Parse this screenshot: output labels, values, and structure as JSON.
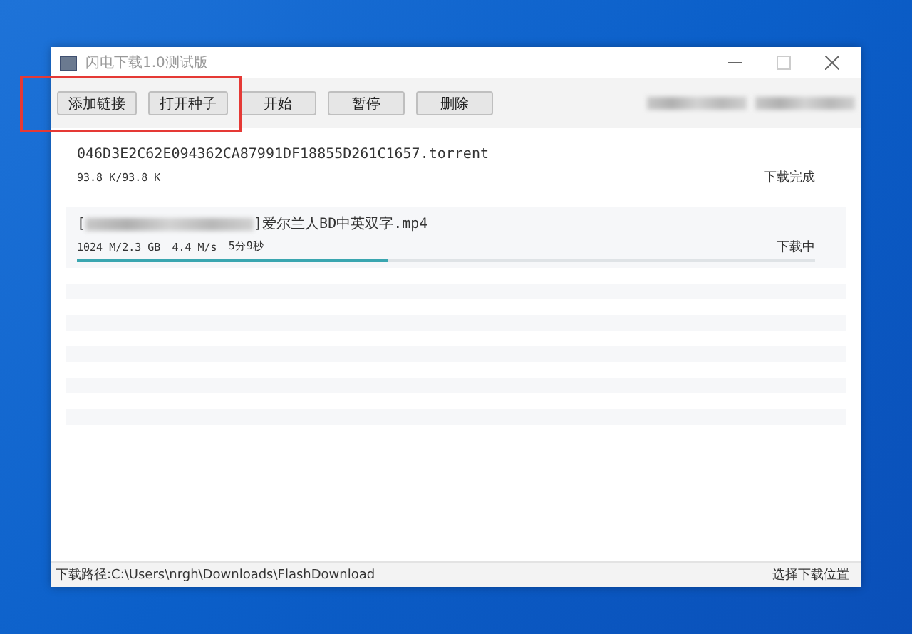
{
  "window": {
    "title": "闪电下载1.0测试版"
  },
  "toolbar": {
    "buttons": [
      "添加链接",
      "打开种子",
      "开始",
      "暂停",
      "删除"
    ]
  },
  "downloads": [
    {
      "name_parts": [
        {
          "kind": "text",
          "text": "046D3E2C62E094362CA87991DF18855D261C1657.torrent"
        }
      ],
      "size": "93.8 K/93.8 K",
      "status": "下载完成"
    },
    {
      "name_parts": [
        {
          "kind": "text",
          "text": "["
        },
        {
          "kind": "redacted"
        },
        {
          "kind": "text",
          "text": "]爱尔兰人BD中英双字.mp4"
        }
      ],
      "size": "1024 M/2.3 GB",
      "speed": "4.4 M/s",
      "remaining": "5分9秒",
      "status": "下载中",
      "level": 0.42
    }
  ],
  "status_bar": {
    "path": "下载路径:C:\\Users\\nrgh\\Downloads\\FlashDownload",
    "action": "选择下载位置"
  }
}
